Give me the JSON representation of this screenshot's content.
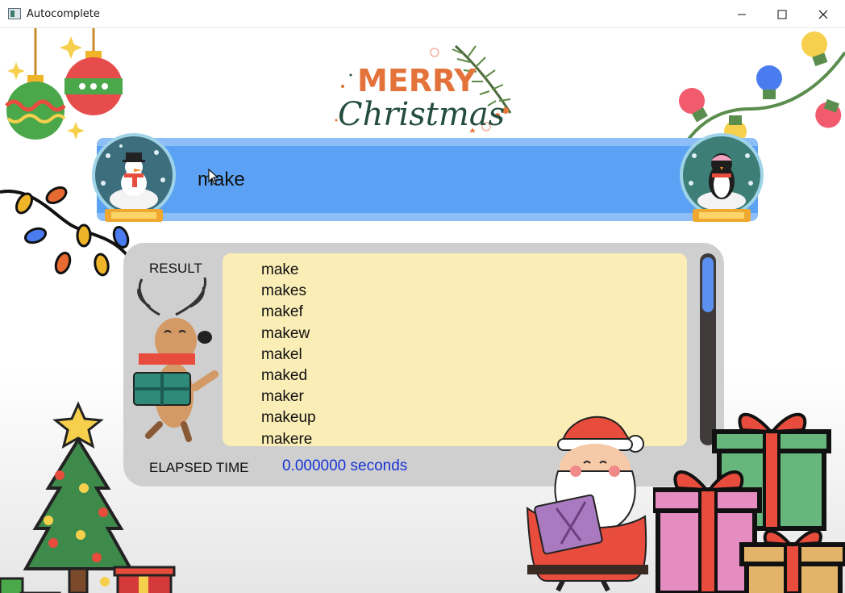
{
  "window": {
    "title": "Autocomplete",
    "controls": {
      "minimize": "minimize-icon",
      "maximize": "maximize-icon",
      "close": "close-icon"
    }
  },
  "banner": {
    "line1": "MERRY",
    "line2": "Christmas"
  },
  "search": {
    "value": "make"
  },
  "results": {
    "label": "RESULT",
    "items": [
      "make",
      "makes",
      "makef",
      "makew",
      "makel",
      "maked",
      "maker",
      "makeup",
      "makere"
    ]
  },
  "elapsed": {
    "label": "ELAPSED TIME",
    "value": "0.000000 seconds"
  },
  "colors": {
    "search_bar": "#5ba2f5",
    "result_panel": "#cfcfcf",
    "result_list": "#faedb6",
    "elapsed_value": "#1633d6",
    "scroll_thumb": "#5b8ff0"
  }
}
